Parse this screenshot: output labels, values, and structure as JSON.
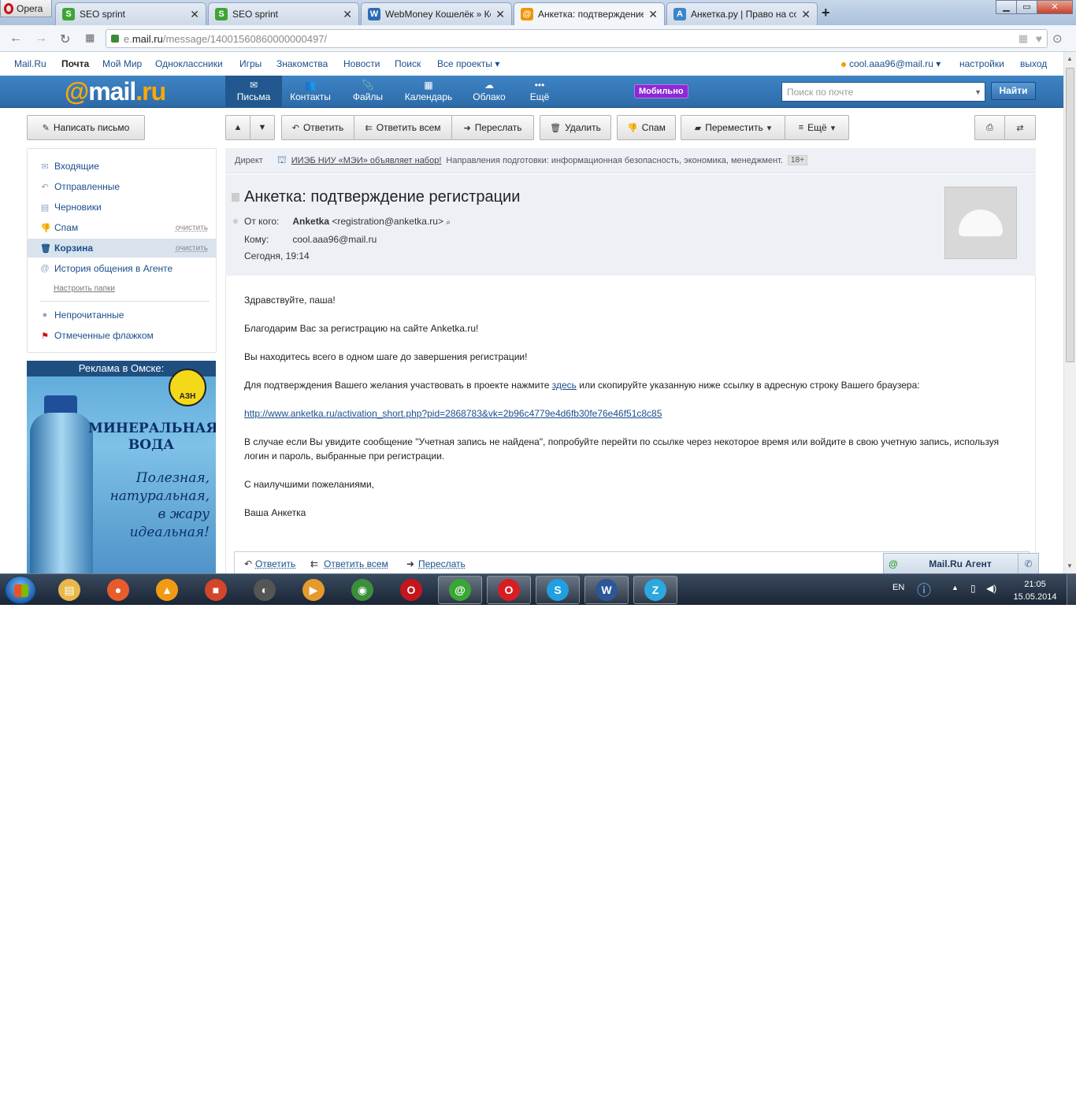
{
  "browser": {
    "menu_label": "Opera",
    "tabs": [
      {
        "label": "SEO sprint",
        "favicon": "S",
        "color": "#3da535"
      },
      {
        "label": "SEO sprint",
        "favicon": "S",
        "color": "#3da535"
      },
      {
        "label": "WebMoney Кошелёк » Ко",
        "favicon": "W",
        "color": "#2c6cb5"
      },
      {
        "label": "Анкетка: подтверждение р",
        "favicon": "@",
        "color": "#f09500",
        "active": true
      },
      {
        "label": "Анкетка.ру | Право на со",
        "favicon": "A",
        "color": "#3b86c9"
      }
    ],
    "url_prefix": "e.",
    "url_domain": "mail.ru",
    "url_path": "/message/14001560860000000497/"
  },
  "toplinks": [
    "Mail.Ru",
    "Почта",
    "Мой Мир",
    "Одноклассники",
    "Игры",
    "Знакомства",
    "Новости",
    "Поиск",
    "Все проекты ▾"
  ],
  "user": {
    "email": "cool.aaa96@mail.ru ▾",
    "settings": "настройки",
    "logout": "выход"
  },
  "header": {
    "logo_at": "@",
    "logo_mail": "mail",
    "logo_ru": ".ru",
    "nav": [
      {
        "label": "Письма",
        "icon": "✉"
      },
      {
        "label": "Контакты",
        "icon": "👥"
      },
      {
        "label": "Файлы",
        "icon": "📎"
      },
      {
        "label": "Календарь",
        "icon": "▦"
      },
      {
        "label": "Облако",
        "icon": "☁"
      },
      {
        "label": "Ещё",
        "icon": "•••"
      }
    ],
    "mobile_badge": "Мобильно",
    "search_placeholder": "Поиск по почте",
    "search_button": "Найти"
  },
  "toolbar": {
    "compose": "Написать письмо",
    "reply": "Ответить",
    "reply_all": "Ответить всем",
    "forward": "Переслать",
    "delete": "Удалить",
    "spam": "Спам",
    "move": "Переместить",
    "more": "Ещё"
  },
  "folders": [
    {
      "label": "Входящие",
      "icon": "✉"
    },
    {
      "label": "Отправленные",
      "icon": "↶"
    },
    {
      "label": "Черновики",
      "icon": "▤"
    },
    {
      "label": "Спам",
      "icon": "👎",
      "clear": "очистить"
    },
    {
      "label": "Корзина",
      "icon": "🗑",
      "clear": "очистить",
      "selected": true
    },
    {
      "label": "История общения в Агенте",
      "icon": "@"
    }
  ],
  "folders_settings": "Настроить папки",
  "filters": [
    {
      "label": "Непрочитанные",
      "icon": "●"
    },
    {
      "label": "Отмеченные флажком",
      "icon": "⚑"
    }
  ],
  "ad": {
    "title": "Реклама в Омске:",
    "logo_text": "АЗН",
    "headline_1": "МИНЕРАЛЬНАЯ",
    "headline_2": "ВОДА",
    "slogan_1": "Полезная,",
    "slogan_2": "натуральная,",
    "slogan_3": "в жару",
    "slogan_4": "идеальная!"
  },
  "direct": {
    "label": "Директ",
    "link": "ИИЭБ НИУ «МЭИ» объявляет набор!",
    "text": "Направления подготовки: информационная безопасность, экономика, менеджмент.",
    "age": "18+"
  },
  "message": {
    "subject": "Анкетка: подтверждение регистрации",
    "from_label": "От кого:",
    "from_name": "Anketka",
    "from_email": "<registration@anketka.ru>",
    "to_label": "Кому:",
    "to": "cool.aaa96@mail.ru",
    "date": "Сегодня, 19:14",
    "greeting": "Здравствуйте, паша!",
    "p1": "Благодарим Вас за регистрацию на сайте Anketka.ru!",
    "p2": "Вы находитесь всего в одном шаге до завершения регистрации!",
    "p3_before": "Для подтверждения Вашего желания участвовать в проекте нажмите ",
    "p3_link": "здесь",
    "p3_after": " или скопируйте указанную ниже ссылку в адресную строку Вашего браузера:",
    "activation_url": "http://www.anketka.ru/activation_short.php?pid=2868783&vk=2b96c4779e4d6fb30fe76e46f51c8c85",
    "p4": "В случае если Вы увидите сообщение \"Учетная запись не найдена\", попробуйте перейти по ссылке через некоторое время или войдите в свою учетную запись, используя логин и пароль, выбранные при регистрации.",
    "p5": "С наилучшими пожеланиями,",
    "signature": "Ваша Анкетка"
  },
  "replybar": {
    "reply": "Ответить",
    "reply_all": "Ответить всем",
    "forward": "Переслать"
  },
  "agent": {
    "label": "Mail.Ru Агент"
  },
  "taskbar": {
    "lang": "EN",
    "time": "21:05",
    "date": "15.05.2014",
    "apps": [
      {
        "icon": "explorer-icon",
        "glyph": "▤",
        "color": "#e7b84a"
      },
      {
        "icon": "yandex-browser-icon",
        "glyph": "●",
        "color": "#e85c2c"
      },
      {
        "icon": "aimp-icon",
        "glyph": "▲",
        "color": "#f29b12"
      },
      {
        "icon": "avg-icon",
        "glyph": "■",
        "color": "#d4452a"
      },
      {
        "icon": "steam-icon",
        "glyph": "◐",
        "color": "#555"
      },
      {
        "icon": "media-player-icon",
        "glyph": "▶",
        "color": "#e79a2c"
      },
      {
        "icon": "chrome-icon",
        "glyph": "◉",
        "color": "#3b8f3b"
      },
      {
        "icon": "opera-next-icon",
        "glyph": "O",
        "color": "#c4161c"
      },
      {
        "icon": "mail-agent-icon",
        "glyph": "@",
        "color": "#3aa635"
      },
      {
        "icon": "opera-icon",
        "glyph": "O",
        "color": "#d81e22"
      },
      {
        "icon": "skype-icon",
        "glyph": "S",
        "color": "#1fa0e0"
      },
      {
        "icon": "word-icon",
        "glyph": "W",
        "color": "#2b5797"
      },
      {
        "icon": "zona-icon",
        "glyph": "Z",
        "color": "#2ca8e0"
      }
    ]
  }
}
